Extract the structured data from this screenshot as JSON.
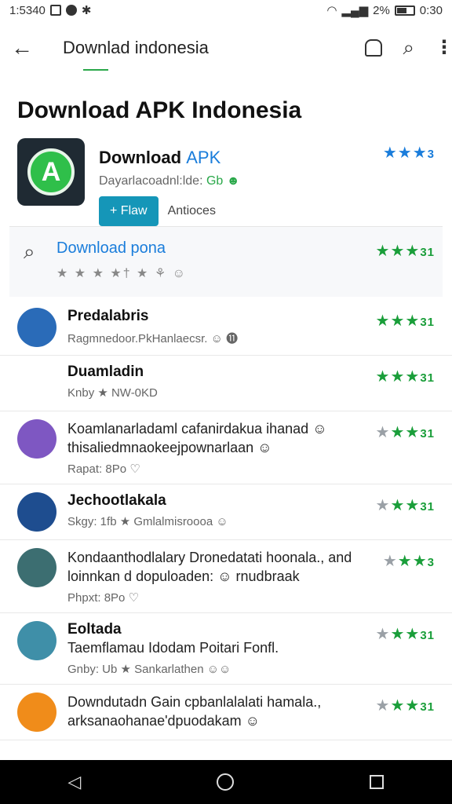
{
  "status": {
    "time": "1:5340",
    "battery": "2%",
    "clock": "0:30"
  },
  "appbar": {
    "title": "Downlad indonesia"
  },
  "page": {
    "heading": "Download APK Indonesia"
  },
  "app": {
    "name_prefix": "Download ",
    "name_accent": "APK",
    "subtitle": "Dayarlacoadnl:lde: ",
    "subtitle_green": "Gb ☻",
    "primary_button": "+ Flaw",
    "secondary_button": "Antioces",
    "rating_text": "★★★",
    "rating_num": "3"
  },
  "search_card": {
    "title": "Download pona",
    "subtitle": "★ ★ ★  ★† ★ ⚘ ☺",
    "rating": "★★★",
    "rating_num": "31"
  },
  "reviews": [
    {
      "name": "Predalabris",
      "body": "",
      "meta": "Ragmnedoor.PkHanlaecsr. ☺ ⓫",
      "meta_style": "g",
      "stars": "★★★",
      "num": "31",
      "avatar": "#2a6bb8"
    },
    {
      "name": "Duamladin",
      "body": "",
      "meta": "Knby ★ NW-0KD",
      "meta_style": "",
      "stars": "★★★",
      "num": "31",
      "avatar": "none"
    },
    {
      "name": "",
      "body": "Koamlanarladaml cafanirdakua ihanad ☺ thisaliedmnaokeejpownarlaan ☺",
      "meta": "Rapat: 8Po ♡",
      "meta_style": "b",
      "stars": "★★★",
      "num": "31",
      "gray_first": true,
      "avatar": "#7e57c2"
    },
    {
      "name": "Jechootlakala",
      "body": "",
      "meta": "Skgy: 1fb ★ Gmlalmisroooa ☺",
      "meta_style": "",
      "stars": "★★★",
      "num": "31",
      "gray_first": true,
      "avatar": "#1e4d8f"
    },
    {
      "name": "",
      "body": "Kondaanthodlalary Dronedatati hoonala., and loinnkan d dopuloaden: ☺ rnudbraak",
      "meta": "Phpxt: 8Po ♡",
      "meta_style": "b",
      "stars": "★★★",
      "num": "3",
      "gray_first": true,
      "avatar": "#3c6e71"
    },
    {
      "name": "Eoltada",
      "body": "Taemflamau Idodam Poitari Fonfl.",
      "meta": "Gnby: Ub ★ Sankarlathen ☺☺",
      "meta_style": "",
      "stars": "★★★",
      "num": "31",
      "gray_first": true,
      "avatar": "#3f8fa8"
    },
    {
      "name": "",
      "body": "Downdutadn Gain cpbanlalalati hamala., arksanaohanae'dpuodakam ☺",
      "meta": "",
      "meta_style": "",
      "stars": "★★★",
      "num": "31",
      "gray_first": true,
      "avatar": "#f08c1a"
    }
  ]
}
